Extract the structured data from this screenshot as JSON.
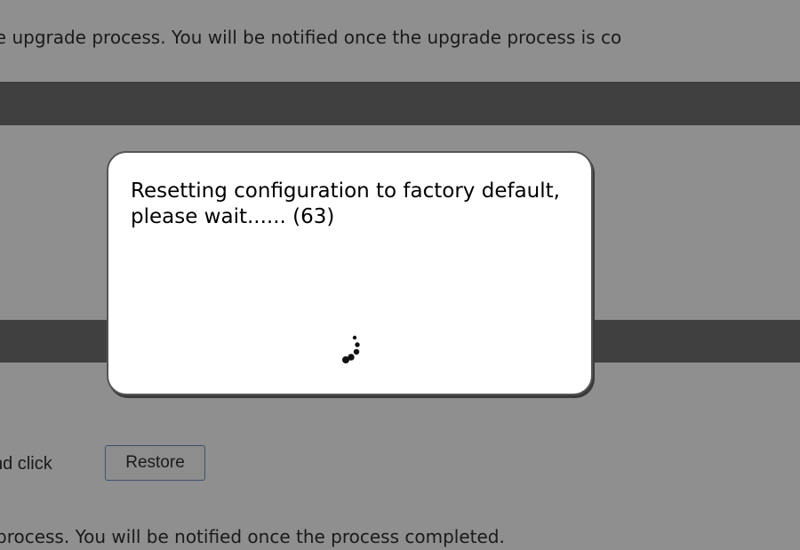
{
  "background": {
    "top_text": "re upgrade process. You will be notified once the upgrade process is co",
    "restore_prefix": "nd click",
    "restore_button_label": "Restore",
    "bottom_text": "process. You will be notified once the process completed."
  },
  "dialog": {
    "message": "Resetting configuration to factory default, please wait...... (63)",
    "spinner_icon": "loading-spinner-icon"
  },
  "colors": {
    "overlay_background": "#8f8f8f",
    "dark_bar": "#404040",
    "dialog_background": "#ffffff",
    "dialog_border": "#555555",
    "button_border": "#3b5170"
  }
}
